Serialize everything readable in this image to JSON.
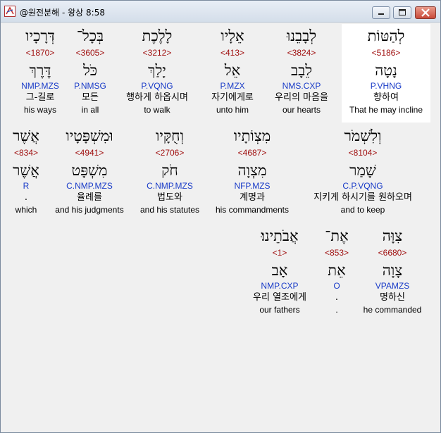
{
  "window": {
    "title": "@원전분해 - 왕상 8:58",
    "minimize_label": "minimize",
    "maximize_label": "maximize",
    "close_label": "close"
  },
  "colors": {
    "number": "#a01010",
    "grammar": "#1a3cc8",
    "highlight": "#ffffff"
  },
  "rows": [
    {
      "words": [
        {
          "hebrew": "לְהַטּוֹת",
          "strong": "<5186>",
          "lemma": "נָטָה",
          "parsing": "P.VHNG",
          "korean": "향하여",
          "english": "That he may incline",
          "highlighted": true
        },
        {
          "hebrew": "לְבָבֵנוּ",
          "strong": "<3824>",
          "lemma": "לֵבָב",
          "parsing": "NMS.CXP",
          "korean": "우리의 마음을",
          "english": "our hearts"
        },
        {
          "hebrew": "אֵלָיו",
          "strong": "<413>",
          "lemma": "אֵל",
          "parsing": "P.MZX",
          "korean": "자기에게로",
          "english": "unto him"
        },
        {
          "hebrew": "לָלֶכֶת",
          "strong": "<3212>",
          "lemma": "יָלַךְ",
          "parsing": "P.VQNG",
          "korean": "행하게 하옵시며",
          "english": "to walk"
        },
        {
          "hebrew": "בְּכָל־",
          "strong": "<3605>",
          "lemma": "כֹּל",
          "parsing": "P.NMSG",
          "korean": "모든",
          "english": "in all"
        },
        {
          "hebrew": "דְּרָכָיו",
          "strong": "<1870>",
          "lemma": "דֶּרֶךְ",
          "parsing": "NMP.MZS",
          "korean": "그-길로",
          "english": "his ways"
        }
      ]
    },
    {
      "words": [
        {
          "hebrew": "וְלִשְׁמֹר",
          "strong": "<8104>",
          "lemma": "שָׁמַר",
          "parsing": "C.P.VQNG",
          "korean": "지키게 하시기를 원하오며",
          "english": "and to keep"
        },
        {
          "hebrew": "מִצְוֹתָיו",
          "strong": "<4687>",
          "lemma": "מִצְוָה",
          "parsing": "NFP.MZS",
          "korean": "계명과",
          "english": "his commandments"
        },
        {
          "hebrew": "וְחֻקָּיו",
          "strong": "<2706>",
          "lemma": "חֹק",
          "parsing": "C.NMP.MZS",
          "korean": "법도와",
          "english": "and his statutes"
        },
        {
          "hebrew": "וּמִשְׁפָּטָיו",
          "strong": "<4941>",
          "lemma": "מִשְׁפָּט",
          "parsing": "C.NMP.MZS",
          "korean": "율례를",
          "english": "and his judgments"
        },
        {
          "hebrew": "אֲשֶׁר",
          "strong": "<834>",
          "lemma": "אֲשֶׁר",
          "parsing": "R",
          "korean": ".",
          "english": "which"
        }
      ]
    },
    {
      "words": [
        {
          "hebrew": "צִוָּה",
          "strong": "<6680>",
          "lemma": "צָוָה",
          "parsing": "VPAMZS",
          "korean": "명하신",
          "english": "he commanded"
        },
        {
          "hebrew": "אֶת־",
          "strong": "<853>",
          "lemma": "אֵת",
          "parsing": "O",
          "korean": ".",
          "english": "."
        },
        {
          "hebrew": "אֲבֹתֵינוּ׃",
          "strong": "<1>",
          "lemma": "אָב",
          "parsing": "NMP.CXP",
          "korean": "우리 열조에게",
          "english": "our fathers"
        }
      ]
    }
  ]
}
